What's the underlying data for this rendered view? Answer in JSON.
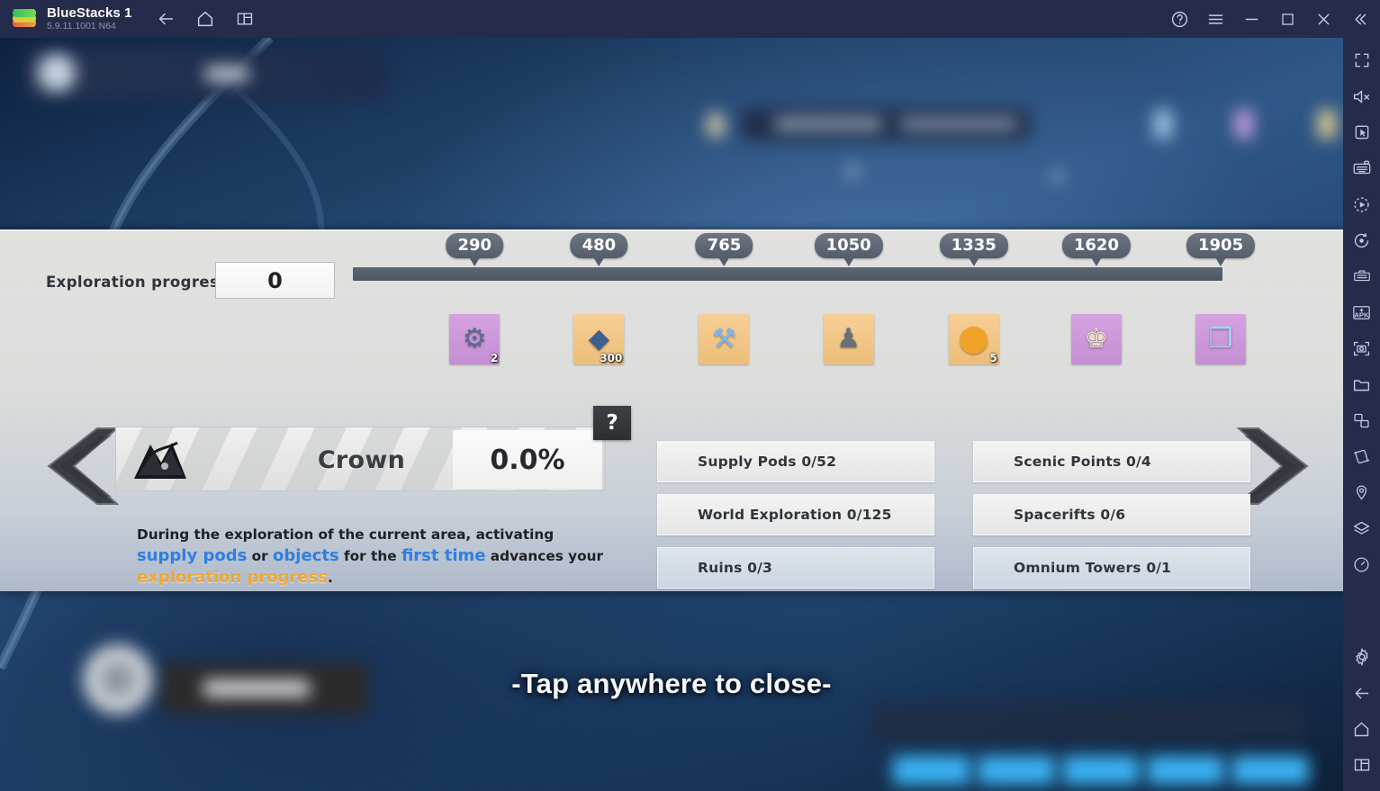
{
  "titlebar": {
    "app_name": "BlueStacks 1",
    "version": "5.9.11.1001  N64",
    "logo_icon": "bluestacks-logo",
    "left_buttons": [
      {
        "name": "back-button",
        "icon": "arrow-left-icon"
      },
      {
        "name": "home-button",
        "icon": "home-icon"
      },
      {
        "name": "multi-instance-button",
        "icon": "windows-icon"
      }
    ],
    "right_buttons": [
      {
        "name": "help-button",
        "icon": "question-circle-icon"
      },
      {
        "name": "menu-button",
        "icon": "hamburger-icon"
      },
      {
        "name": "minimize-button",
        "icon": "minimize-icon"
      },
      {
        "name": "maximize-button",
        "icon": "maximize-icon"
      },
      {
        "name": "close-button",
        "icon": "close-icon"
      },
      {
        "name": "collapse-sidebar-button",
        "icon": "chevrons-left-icon"
      }
    ]
  },
  "panel": {
    "progress_label": "Exploration progress",
    "progress_value": "0",
    "track": {
      "fill_percent": 0,
      "milestones": [
        {
          "value": "290",
          "pos": 14.0,
          "rarity": "rare",
          "icon": "ore-chunks-icon",
          "qty": "2"
        },
        {
          "value": "480",
          "pos": 28.3,
          "rarity": "common",
          "icon": "blue-crystal-icon",
          "qty": "300"
        },
        {
          "value": "765",
          "pos": 42.7,
          "rarity": "common",
          "icon": "hammer-icon",
          "qty": ""
        },
        {
          "value": "1050",
          "pos": 57.0,
          "rarity": "common",
          "icon": "mech-figure-icon",
          "qty": ""
        },
        {
          "value": "1335",
          "pos": 71.4,
          "rarity": "common",
          "icon": "golden-orb-icon",
          "qty": "5"
        },
        {
          "value": "1620",
          "pos": 85.5,
          "rarity": "rare",
          "icon": "character-skin-icon",
          "qty": ""
        },
        {
          "value": "1905",
          "pos": 99.8,
          "rarity": "rare",
          "icon": "blueprint-card-icon",
          "qty": ""
        }
      ]
    },
    "region": {
      "emblem_icon": "crown-region-emblem",
      "name": "Crown",
      "percent": "0.0%",
      "help_label": "?",
      "prev_icon": "chevron-left-icon",
      "next_icon": "chevron-right-icon"
    },
    "description": {
      "part1": "During the exploration of the current area, activating ",
      "blue1": "supply pods",
      "mid1": " or ",
      "blue2": "objects",
      "mid2": " for the ",
      "blue3": "first time",
      "mid3": " advances your ",
      "orange": "exploration progress",
      "end": "."
    },
    "checklist_left": [
      "Supply Pods 0/52",
      "World Exploration 0/125",
      "Ruins 0/3"
    ],
    "checklist_right": [
      "Scenic Points 0/4",
      "Spacerifts 0/6",
      "Omnium Towers 0/1"
    ]
  },
  "overlay": {
    "tap_to_close": "-Tap anywhere to close-"
  },
  "sidebar": {
    "items": [
      {
        "name": "fullscreen-button",
        "icon": "fullscreen-icon"
      },
      {
        "name": "mute-button",
        "icon": "speaker-mute-icon"
      },
      {
        "name": "game-controls-button",
        "icon": "cursor-box-icon"
      },
      {
        "name": "keymapping-button",
        "icon": "keyboard-icon"
      },
      {
        "name": "macro-recorder-button",
        "icon": "play-record-icon"
      },
      {
        "name": "screen-record-button",
        "icon": "record-circle-icon"
      },
      {
        "name": "multi-instance-manager",
        "icon": "instance-manager-icon"
      },
      {
        "name": "install-apk-button",
        "icon": "apk-icon"
      },
      {
        "name": "screenshot-button",
        "icon": "camera-icon"
      },
      {
        "name": "media-manager-button",
        "icon": "folder-icon"
      },
      {
        "name": "rotate-button",
        "icon": "rotate-screen-icon"
      },
      {
        "name": "shake-button",
        "icon": "shake-icon"
      },
      {
        "name": "location-button",
        "icon": "location-pin-icon"
      },
      {
        "name": "eco-mode-button",
        "icon": "layers-icon"
      },
      {
        "name": "performance-button",
        "icon": "gauge-icon"
      }
    ],
    "bottom_items": [
      {
        "name": "settings-button",
        "icon": "gear-icon"
      },
      {
        "name": "back-button",
        "icon": "arrow-left-icon"
      },
      {
        "name": "home-button",
        "icon": "home-icon"
      },
      {
        "name": "recents-button",
        "icon": "windows-icon"
      }
    ]
  },
  "colors": {
    "chrome": "#252b4a",
    "panel_top": "#e2e2e0",
    "panel_bottom": "#aebacb",
    "track": "#5d6773",
    "accent_blue": "#2f7fe0",
    "accent_orange": "#f0a830",
    "rare": "#c48ed4",
    "common": "#edbd78"
  }
}
